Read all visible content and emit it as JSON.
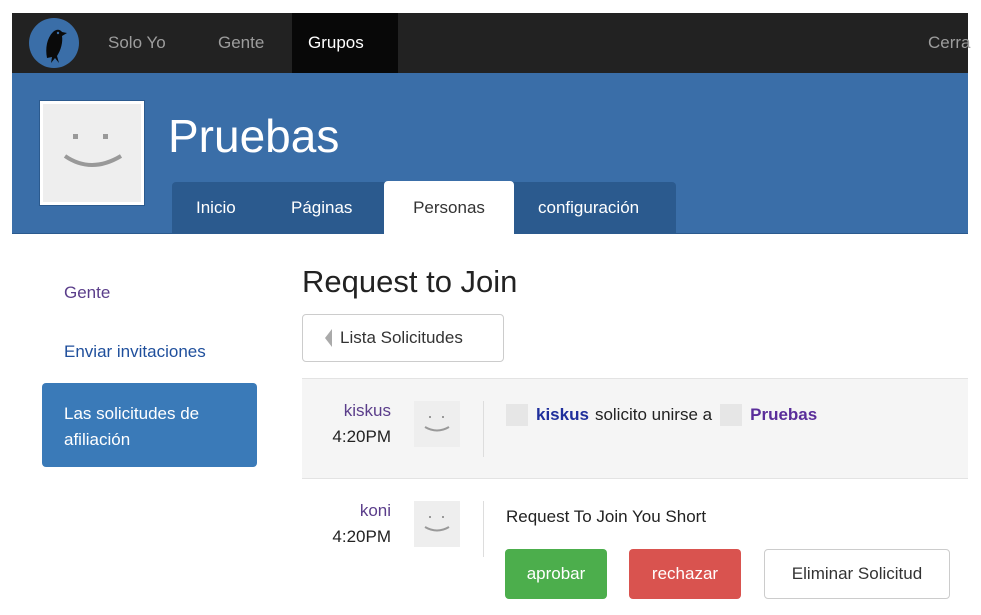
{
  "topnav": {
    "items": [
      "Solo Yo",
      "Gente",
      "Grupos"
    ],
    "logout": "Cerra"
  },
  "group": {
    "name": "Pruebas",
    "tabs": [
      "Inicio",
      "Páginas",
      "Personas",
      "configuración"
    ]
  },
  "sidebar": {
    "items": [
      "Gente",
      "Enviar invitaciones",
      "Las solicitudes de afiliación"
    ]
  },
  "main": {
    "title": "Request to Join",
    "back_label": "Lista Solicitudes",
    "items": [
      {
        "user": "kiskus",
        "time": "4:20PM",
        "actor": "kiskus",
        "action": "solicito unirse a",
        "group": "Pruebas"
      },
      {
        "user": "koni",
        "time": "4:20PM",
        "message": "Request To Join You Short",
        "approve": "aprobar",
        "reject": "rechazar",
        "delete": "Eliminar Solicitud"
      }
    ]
  },
  "colors": {
    "topbar": "#222222",
    "header": "#3a6ea8",
    "sidebar_active": "#3a7ab8",
    "approve": "#4cae4c",
    "reject": "#d9534f"
  }
}
